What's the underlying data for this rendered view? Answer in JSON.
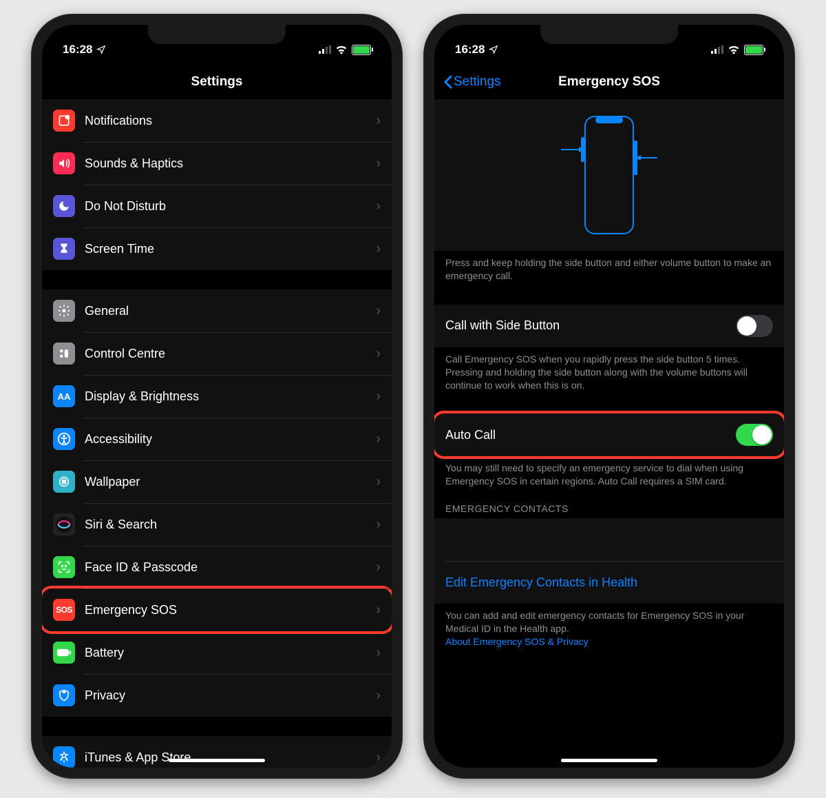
{
  "status": {
    "time": "16:28"
  },
  "left": {
    "title": "Settings",
    "group1": [
      {
        "id": "notifications",
        "label": "Notifications",
        "color": "#ff3b30"
      },
      {
        "id": "sounds",
        "label": "Sounds & Haptics",
        "color": "#ff2d55"
      },
      {
        "id": "dnd",
        "label": "Do Not Disturb",
        "color": "#5856d6"
      },
      {
        "id": "screentime",
        "label": "Screen Time",
        "color": "#5856d6"
      }
    ],
    "group2": [
      {
        "id": "general",
        "label": "General",
        "color": "#8e8e93"
      },
      {
        "id": "controlcentre",
        "label": "Control Centre",
        "color": "#8e8e93"
      },
      {
        "id": "display",
        "label": "Display & Brightness",
        "color": "#0a84ff"
      },
      {
        "id": "accessibility",
        "label": "Accessibility",
        "color": "#0a84ff"
      },
      {
        "id": "wallpaper",
        "label": "Wallpaper",
        "color": "#30b0c7"
      },
      {
        "id": "siri",
        "label": "Siri & Search",
        "color": "#222"
      },
      {
        "id": "faceid",
        "label": "Face ID & Passcode",
        "color": "#32d74b"
      },
      {
        "id": "sos",
        "label": "Emergency SOS",
        "color": "#ff3b30",
        "highlight": true
      },
      {
        "id": "battery",
        "label": "Battery",
        "color": "#32d74b"
      },
      {
        "id": "privacy",
        "label": "Privacy",
        "color": "#0a84ff"
      }
    ],
    "group3": [
      {
        "id": "itunes",
        "label": "iTunes & App Store",
        "color": "#0a84ff"
      }
    ]
  },
  "right": {
    "back": "Settings",
    "title": "Emergency SOS",
    "illus_footer": "Press and keep holding the side button and either volume button to make an emergency call.",
    "call_side": {
      "label": "Call with Side Button",
      "on": false,
      "footer": "Call Emergency SOS when you rapidly press the side button 5 times. Pressing and holding the side button along with the volume buttons will continue to work when this is on."
    },
    "auto_call": {
      "label": "Auto Call",
      "on": true,
      "highlight": true,
      "footer": "You may still need to specify an emergency service to dial when using Emergency SOS in certain regions. Auto Call requires a SIM card."
    },
    "contacts_header": "EMERGENCY CONTACTS",
    "edit_link": "Edit Emergency Contacts in Health",
    "contacts_footer": "You can add and edit emergency contacts for Emergency SOS in your Medical ID in the Health app.",
    "privacy_link": "About Emergency SOS & Privacy"
  }
}
